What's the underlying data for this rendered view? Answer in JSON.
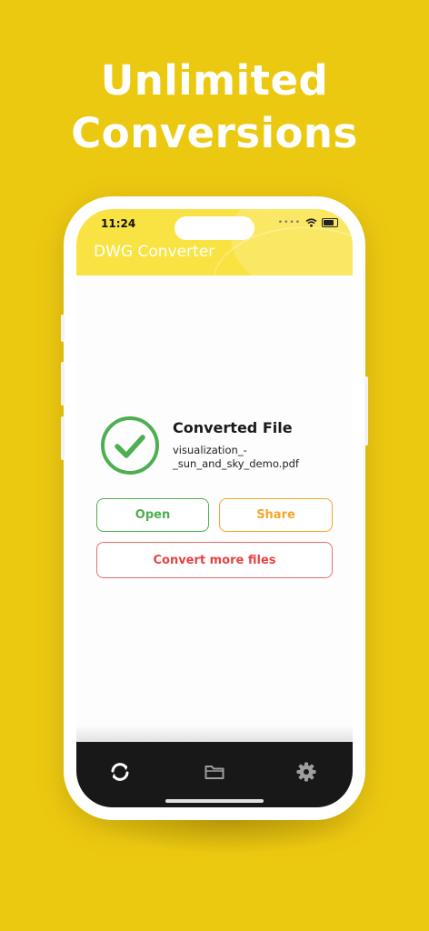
{
  "promo": {
    "headline_line1": "Unlimited",
    "headline_line2": "Conversions"
  },
  "status_bar": {
    "time": "11:24"
  },
  "app": {
    "title": "DWG Converter"
  },
  "result": {
    "title": "Converted File",
    "file_name": "visualization_-_sun_and_sky_demo.pdf",
    "file_name_line1": "visualization_-",
    "file_name_line2": "_sun_and_sky_demo.pdf"
  },
  "actions": {
    "open_label": "Open",
    "share_label": "Share",
    "convert_more_label": "Convert more files"
  },
  "tabbar": {
    "tabs": [
      {
        "icon": "refresh-icon",
        "active": true
      },
      {
        "icon": "folder-icon",
        "active": false
      },
      {
        "icon": "gear-icon",
        "active": false
      }
    ]
  },
  "colors": {
    "background": "#ecc911",
    "header": "#f9e343",
    "success": "#4caf50",
    "share": "#f4a62a",
    "convert": "#e84343",
    "tabbar": "#181818"
  }
}
